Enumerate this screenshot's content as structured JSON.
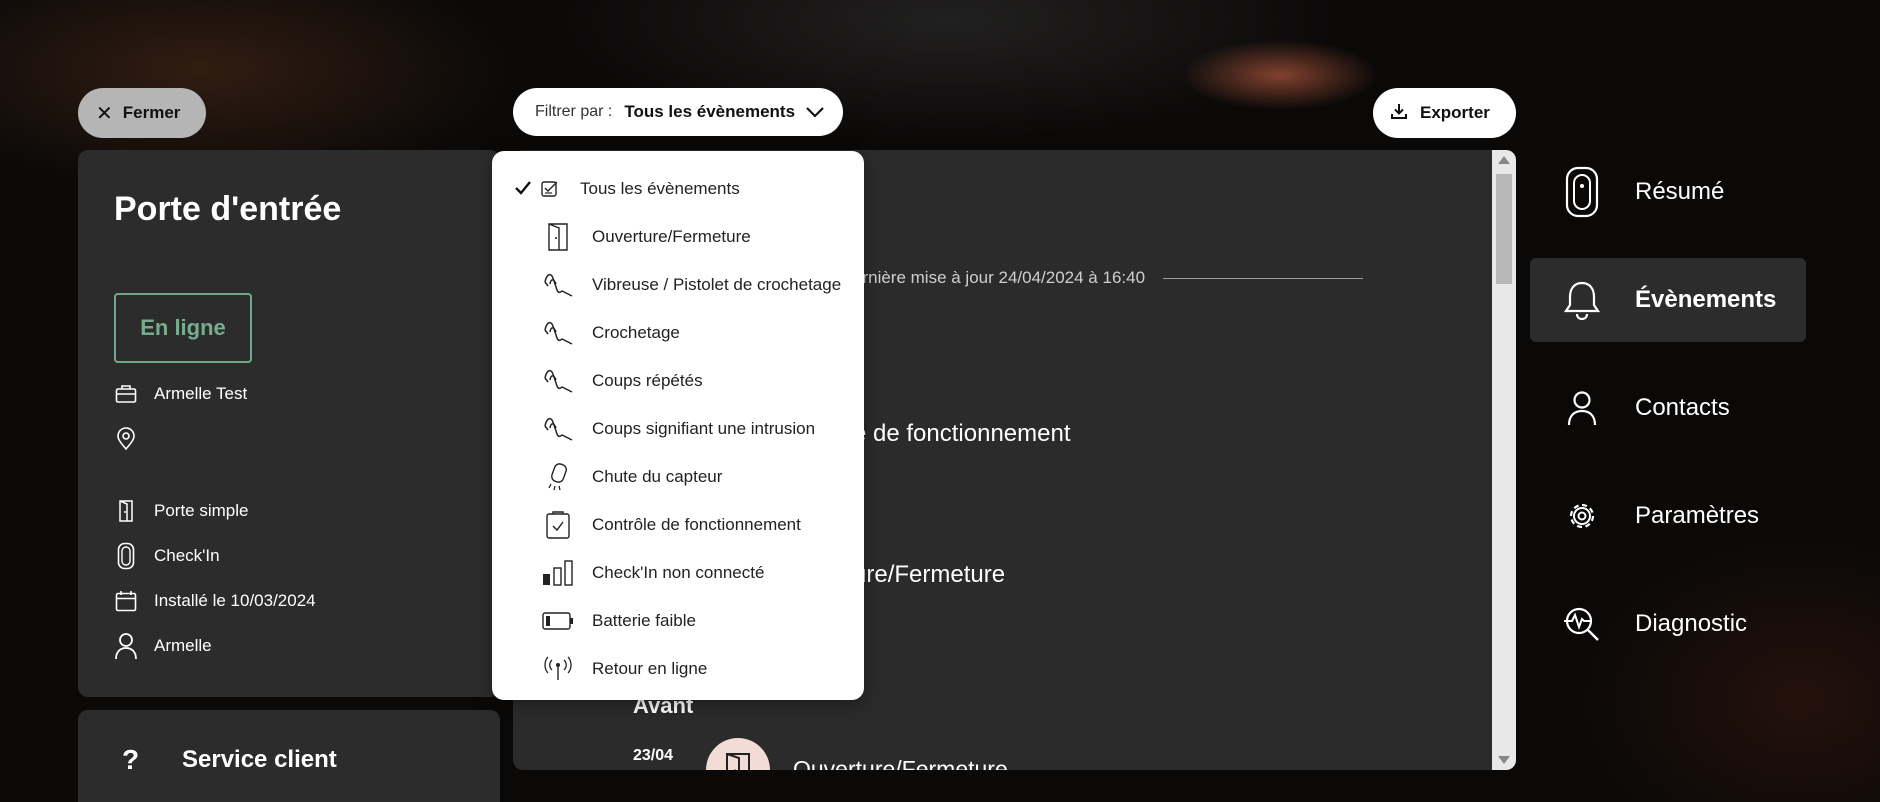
{
  "toolbar": {
    "close_label": "Fermer",
    "filter_prefix": "Filtrer par :",
    "filter_value": "Tous les évènements",
    "export_label": "Exporter"
  },
  "device": {
    "title": "Porte d'entrée",
    "status": "En ligne",
    "owner": "Armelle Test",
    "location": "",
    "door_type": "Porte simple",
    "model": "Check'In",
    "installed": "Installé le 10/03/2024",
    "user": "Armelle",
    "status_color": "#6fa98c"
  },
  "service": {
    "icon": "?",
    "label": "Service client"
  },
  "events": {
    "last_update": "ernière mise à jour 24/04/2024 à 16:40",
    "item1": "e de fonctionnement",
    "item2": "ure/Fermeture",
    "before_label": "Avant",
    "item3_date": "23/04",
    "item3_text": "Ouverture/Fermeture"
  },
  "filter_options": [
    {
      "label": "Tous les évènements",
      "icon": "checklist-icon",
      "selected": true
    },
    {
      "label": "Ouverture/Fermeture",
      "icon": "door-icon"
    },
    {
      "label": "Vibreuse / Pistolet de crochetage",
      "icon": "pick-icon"
    },
    {
      "label": "Crochetage",
      "icon": "pick-icon"
    },
    {
      "label": "Coups répétés",
      "icon": "pick-icon"
    },
    {
      "label": "Coups signifiant une intrusion",
      "icon": "pick-icon"
    },
    {
      "label": "Chute du capteur",
      "icon": "falling-sensor-icon"
    },
    {
      "label": "Contrôle de fonctionnement",
      "icon": "clipboard-check-icon"
    },
    {
      "label": "Check'In non connecté",
      "icon": "signal-bars-icon"
    },
    {
      "label": "Batterie faible",
      "icon": "battery-low-icon"
    },
    {
      "label": "Retour en ligne",
      "icon": "antenna-icon"
    }
  ],
  "nav": [
    {
      "label": "Résumé",
      "icon": "device-icon"
    },
    {
      "label": "Évènements",
      "icon": "bell-icon",
      "active": true
    },
    {
      "label": "Contacts",
      "icon": "person-icon"
    },
    {
      "label": "Paramètres",
      "icon": "gear-icon"
    },
    {
      "label": "Diagnostic",
      "icon": "diagnostic-icon"
    }
  ]
}
